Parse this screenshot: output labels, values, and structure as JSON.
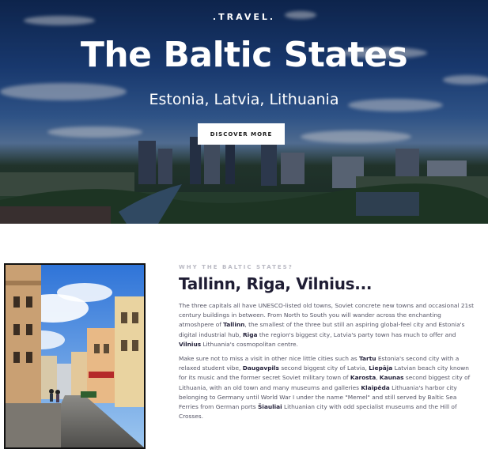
{
  "hero": {
    "eyebrow": ".TRAVEL.",
    "title": "The Baltic States",
    "subtitle": "Estonia, Latvia, Lithuania",
    "cta_label": "DISCOVER MORE"
  },
  "section": {
    "kicker": "WHY THE BALTIC STATES?",
    "title": "Tallinn, Riga, Vilnius...",
    "p1": [
      {
        "t": "The three capitals all have UNESCO-listed old towns, Soviet concrete new towns and occasional 21st century buildings in between. From North to South you will wander across the enchanting atmoshpere of "
      },
      {
        "t": "Tallinn",
        "b": true
      },
      {
        "t": ", the smallest of the three but still an aspiring global-feel city and Estonia's digital industrial hub, "
      },
      {
        "t": "Riga",
        "b": true
      },
      {
        "t": " the region's biggest city, Latvia's party town has much to offer and "
      },
      {
        "t": "Vilnius",
        "b": true
      },
      {
        "t": " Lithuania's cosmopolitan centre."
      }
    ],
    "p2": [
      {
        "t": "Make sure not to miss a visit in other nice little cities such as "
      },
      {
        "t": "Tartu",
        "b": true
      },
      {
        "t": " Estonia's second city with a relaxed student vibe, "
      },
      {
        "t": "Daugavpils",
        "b": true
      },
      {
        "t": " second biggest city of Latvia, "
      },
      {
        "t": "Liepāja",
        "b": true
      },
      {
        "t": " Latvian beach city known for its music and the former secret Soviet military town of "
      },
      {
        "t": "Karosta",
        "b": true
      },
      {
        "t": ", "
      },
      {
        "t": "Kaunas",
        "b": true
      },
      {
        "t": " second biggest city of Lithuania, with an old town and many museums and galleries "
      },
      {
        "t": "Klaipėda",
        "b": true
      },
      {
        "t": " Lithuania's harbor city belonging to Germany until World War I under the name \"Memel\" and still served by Baltic Sea Ferries from German ports "
      },
      {
        "t": "Šiauliai",
        "b": true
      },
      {
        "t": " Lithuanian city with odd specialist museums and the Hill of Crosses."
      }
    ]
  }
}
